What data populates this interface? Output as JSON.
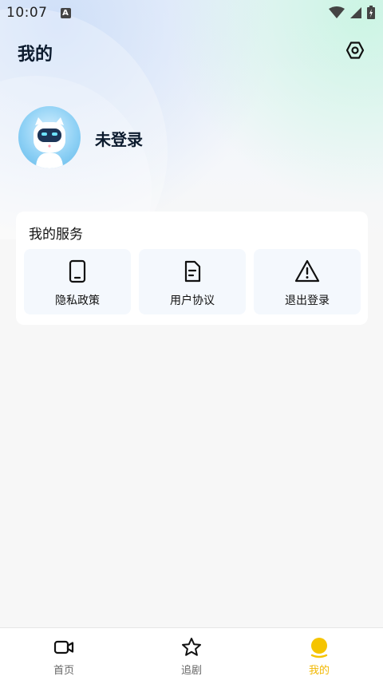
{
  "status_bar": {
    "time": "10:07",
    "notification_badge": "A"
  },
  "header": {
    "title": "我的",
    "settings_icon": "settings-hexagon-icon"
  },
  "profile": {
    "avatar_icon": "robot-avatar",
    "username": "未登录"
  },
  "services": {
    "title": "我的服务",
    "items": [
      {
        "label": "隐私政策",
        "icon": "phone-icon"
      },
      {
        "label": "用户协议",
        "icon": "document-icon"
      },
      {
        "label": "退出登录",
        "icon": "warning-icon"
      }
    ]
  },
  "tabbar": {
    "tabs": [
      {
        "label": "首页",
        "icon": "video-camera-icon",
        "active": false
      },
      {
        "label": "追剧",
        "icon": "star-icon",
        "active": false
      },
      {
        "label": "我的",
        "icon": "profile-dot-icon",
        "active": true
      }
    ]
  },
  "colors": {
    "accent": "#f2b800",
    "title_text": "#0c1b2e",
    "card_bg": "#ffffff",
    "service_bg": "#f4f8fd"
  }
}
